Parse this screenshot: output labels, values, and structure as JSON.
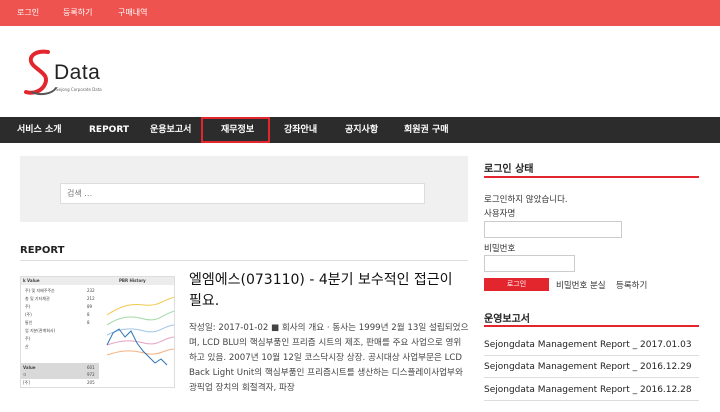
{
  "topbar": {
    "login": "로그인",
    "register": "등록하기",
    "purchases": "구매내역"
  },
  "logo": {
    "word": "Data",
    "sub": "Sejong Corporate Data"
  },
  "nav": {
    "items": [
      "서비스 소개",
      "REPORT",
      "운용보고서",
      "재무정보",
      "강좌안내",
      "공지사항",
      "회원권 구매"
    ]
  },
  "search": {
    "placeholder": "검색 …"
  },
  "report_section": {
    "title": "REPORT"
  },
  "thumbnail": {
    "left_header": "k Value",
    "right_header": "PBR History",
    "rows": [
      "주) 및 지배주주순",
      "총 및 기타채권",
      "주)",
      "(주)",
      "통인",
      "업 지분(관계회사)",
      "주)",
      "산",
      "Value",
      "ㅁ"
    ],
    "values": [
      "232",
      "212",
      "89",
      "8",
      "8",
      "",
      "",
      "",
      "601",
      "972"
    ],
    "bottom_rows": [
      "[주]",
      ""
    ],
    "bottom_values": [
      "",
      "205"
    ]
  },
  "article": {
    "title": "엘엠에스(073110) - 4분기 보수적인 접근이 필요.",
    "body": "작성일: 2017-01-02 ■ 회사의 개요 · 동사는 1999년 2월 13일 설립되었으며, LCD BLU의 핵심부품인 프리즘 시트의 제조, 판매를 주요 사업으로 영위하고 있음. 2007년 10월 12일 코스닥시장 상장. 공시대상 사업부문은 LCD Back Light Unit의 핵심부품인 프리즘시트를 생산하는 디스플레이사업부와 광픽업 장치의 회절격자, 파장"
  },
  "sidebar": {
    "login_title": "로그인 상태",
    "not_logged_in": "로그인하지 않았습니다.",
    "username_label": "사용자명",
    "password_label": "비밀번호",
    "login_button": "로그인",
    "lost_password": "비밀번호 분실",
    "register": "등록하기",
    "reports_title": "운영보고서",
    "reports": [
      "Sejongdata Management Report _ 2017.01.03",
      "Sejongdata Management Report _ 2016.12.29",
      "Sejongdata Management Report _ 2016.12.28"
    ]
  },
  "colors": {
    "accent": "#e3262e",
    "topbar": "#ef5350",
    "nav_bg": "#2c2c2c"
  }
}
